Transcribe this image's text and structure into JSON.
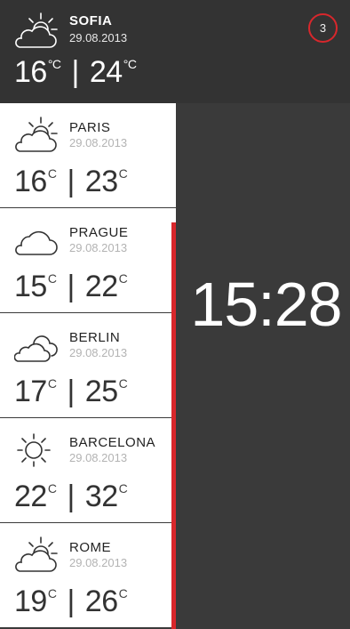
{
  "header": {
    "city": "SOFIA",
    "date": "29.08.2013",
    "low": "16",
    "high": "24",
    "unit": "°C",
    "icon": "partly-cloudy-icon"
  },
  "badge": {
    "count": "3"
  },
  "clock": {
    "time": "15:28"
  },
  "unit_symbol": "C",
  "cities": [
    {
      "name": "PARIS",
      "date": "29.08.2013",
      "low": "16",
      "high": "23",
      "icon": "partly-cloudy-icon"
    },
    {
      "name": "PRAGUE",
      "date": "29.08.2013",
      "low": "15",
      "high": "22",
      "icon": "cloud-icon"
    },
    {
      "name": "BERLIN",
      "date": "29.08.2013",
      "low": "17",
      "high": "25",
      "icon": "cloudy-icon"
    },
    {
      "name": "BARCELONA",
      "date": "29.08.2013",
      "low": "22",
      "high": "32",
      "icon": "sun-icon"
    },
    {
      "name": "ROME",
      "date": "29.08.2013",
      "low": "19",
      "high": "26",
      "icon": "partly-cloudy-icon"
    }
  ],
  "colors": {
    "accent": "#d8272c",
    "background": "#3a3a3a",
    "card": "#ffffff"
  }
}
